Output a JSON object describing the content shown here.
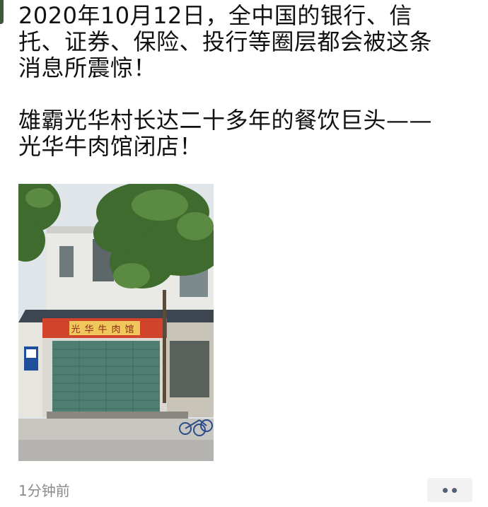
{
  "post": {
    "paragraph_1": {
      "line_1": "2020年10月12日，全中国的银行、信",
      "line_2": "托、证券、保险、投行等圈层都会被这条",
      "line_3": "消息所震惊！"
    },
    "paragraph_2": {
      "line_1": "雄霸光华村长达二十多年的餐饮巨头——",
      "line_2": "光华牛肉馆闭店！"
    },
    "photo": {
      "signboard_text": "光华牛肉馆"
    },
    "timestamp": "1分钟前",
    "more_icon": "more-dots-icon"
  },
  "colors": {
    "text": "#111111",
    "meta": "#8a8a8a",
    "more_bg": "#f2f2f2",
    "more_dots": "#54607a"
  }
}
